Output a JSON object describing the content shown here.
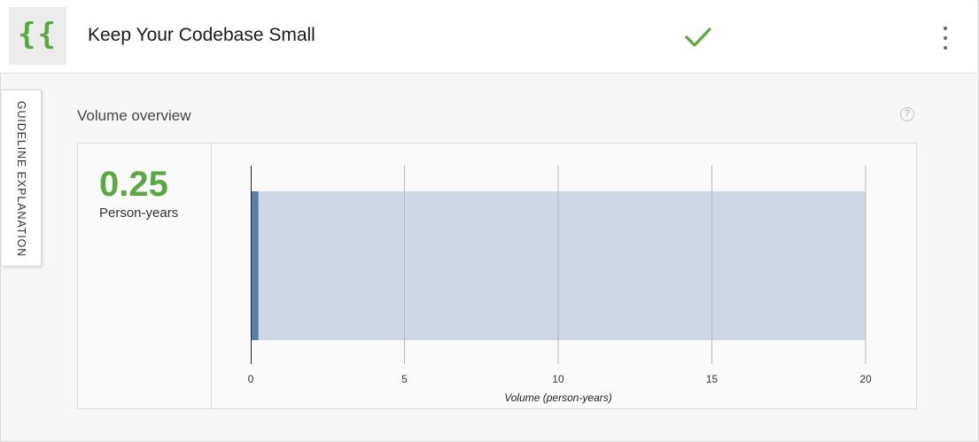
{
  "header": {
    "logo_text": "{{",
    "title": "Keep Your Codebase Small",
    "status_icon": "check-icon",
    "menu_icon": "kebab-menu-icon"
  },
  "side_tab": {
    "label": "GUIDELINE EXPLANATION"
  },
  "section": {
    "title": "Volume overview",
    "help_glyph": "?"
  },
  "metric": {
    "value": "0.25",
    "unit": "Person-years"
  },
  "colors": {
    "accent_green": "#5aa842",
    "bar_fill": "#5a7fa6",
    "range_fill": "#cdd8e4"
  },
  "chart_data": {
    "type": "bar",
    "orientation": "horizontal",
    "values": [
      0.25
    ],
    "range_max": 20,
    "xlim": [
      0,
      20
    ],
    "xticks": [
      0,
      5,
      10,
      15,
      20
    ],
    "xlabel": "Volume (person-years)",
    "grid": true
  }
}
